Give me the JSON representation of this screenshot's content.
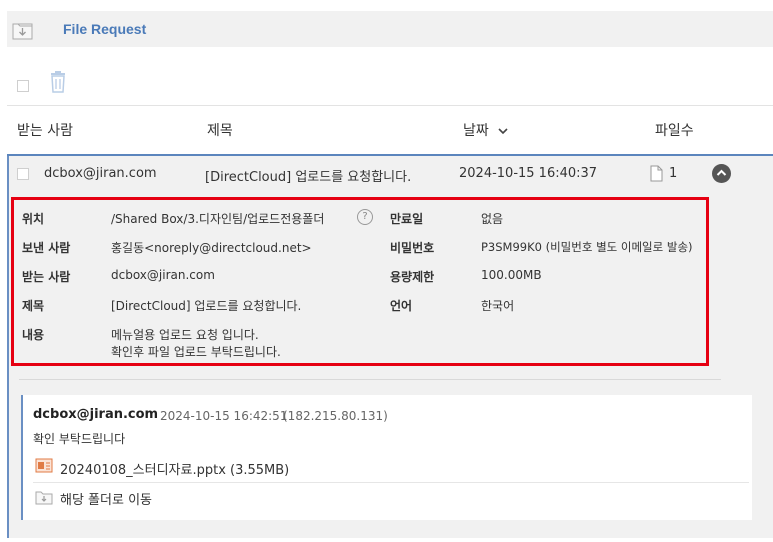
{
  "app": {
    "title": "File Request"
  },
  "table": {
    "headers": {
      "recipient": "받는 사람",
      "subject": "제목",
      "date": "날짜",
      "files": "파일수"
    },
    "row": {
      "recipient": "dcbox@jiran.com",
      "subject": "[DirectCloud] 업로드를 요청합니다.",
      "date": "2024-10-15 16:40:37",
      "file_count": "1"
    }
  },
  "details": {
    "location_label": "위치",
    "location_value": "/Shared Box/3.디자인팀/업로드전용폴더",
    "sender_label": "보낸 사람",
    "sender_value": "홍길동<noreply@directcloud.net>",
    "recipient_label": "받는 사람",
    "recipient_value": "dcbox@jiran.com",
    "subject_label": "제목",
    "subject_value": "[DirectCloud] 업로드를 요청합니다.",
    "content_label": "내용",
    "content_line1": "메뉴얼용 업로드 요청 입니다.",
    "content_line2": "확인후 파일 업로드 부탁드립니다.",
    "expiry_label": "만료일",
    "expiry_value": "없음",
    "password_label": "비밀번호",
    "password_value": "P3SM99K0 (비밀번호 별도 이메일로 발송)",
    "capacity_label": "용량제한",
    "capacity_value": "100.00MB",
    "language_label": "언어",
    "language_value": "한국어",
    "help_symbol": "?"
  },
  "comment": {
    "author": "dcbox@jiran.com",
    "time": "2024-10-15 16:42:51",
    "ip": "(182.215.80.131)",
    "message": "확인 부탁드립니다",
    "file": "20240108_스터디자료.pptx (3.55MB)",
    "move_label": "해당 폴더로 이동"
  },
  "colors": {
    "accent": "#4a7ab8",
    "highlight_border": "#e60012",
    "row_bg": "#f1f1f1"
  },
  "icons": [
    "folder-request-icon",
    "trash-icon",
    "sort-chevron-down-icon",
    "file-icon",
    "collapse-chevron-up-icon",
    "help-icon",
    "pptx-file-icon",
    "folder-move-icon"
  ]
}
